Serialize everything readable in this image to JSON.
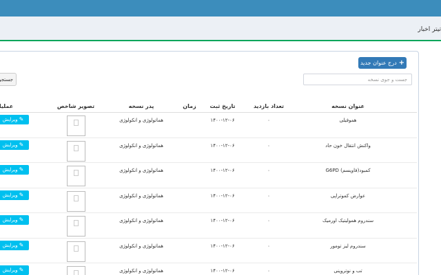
{
  "header": {
    "page_title": "تیتر اخبار"
  },
  "toolbar": {
    "add_label": "درج عنوان جدید",
    "search_placeholder": "جست و جوی نسخه",
    "search_button_label": "جستجو"
  },
  "table": {
    "columns": {
      "title": "عنوان نسخه",
      "visits": "تعداد بازدید",
      "registered": "تاریخ ثبت",
      "time": "زمان",
      "parent": "پدر نسخه",
      "thumbnail": "تصویر شاخص",
      "actions": "عملیات"
    },
    "edit_label": "ویرایش",
    "rows": [
      {
        "title": "هموفیلی",
        "visits": "۰",
        "registered": "۱۴۰۰-۱۲-۰۶",
        "time": "",
        "parent": "هماتولوژی و انکولوژی"
      },
      {
        "title": "واکنش انتقال خون حاد",
        "visits": "۰",
        "registered": "۱۴۰۰-۱۲-۰۶",
        "time": "",
        "parent": "هماتولوژی و انکولوژی"
      },
      {
        "title": "کمبود(فاویسم) G6PD",
        "visits": "۰",
        "registered": "۱۴۰۰-۱۲-۰۶",
        "time": "",
        "parent": "هماتولوژی و انکولوژی"
      },
      {
        "title": "عوارض کموتراپی",
        "visits": "۰",
        "registered": "۱۴۰۰-۱۲-۰۶",
        "time": "",
        "parent": "هماتولوژی و انکولوژی"
      },
      {
        "title": "سندروم همولیتیک اورمیک",
        "visits": "۰",
        "registered": "۱۴۰۰-۱۲-۰۶",
        "time": "",
        "parent": "هماتولوژی و انکولوژی"
      },
      {
        "title": "سندروم لیز تومور",
        "visits": "۰",
        "registered": "۱۴۰۰-۱۲-۰۶",
        "time": "",
        "parent": "هماتولوژی و انکولوژی"
      },
      {
        "title": "تب و نوتروپنی",
        "visits": "۰",
        "registered": "۱۴۰۰-۱۲-۰۶",
        "time": "",
        "parent": "هماتولوژی و انکولوژی"
      }
    ]
  }
}
